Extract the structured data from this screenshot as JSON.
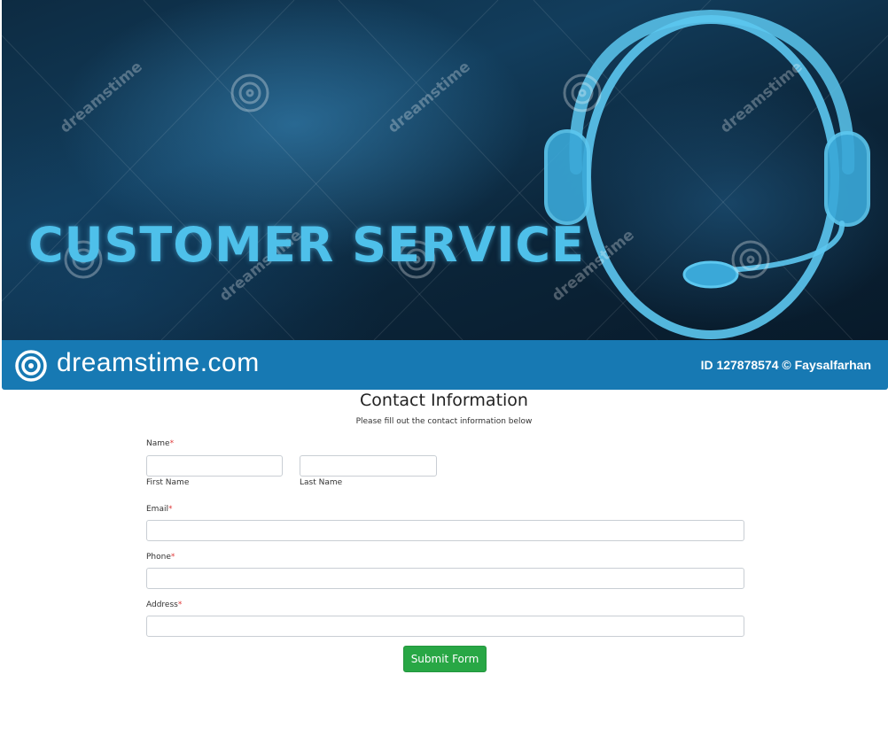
{
  "banner": {
    "headline": "CUSTOMER SERVICE",
    "watermark_text": "dreamstime",
    "brand_name": "dreamstime.com",
    "image_credit": "ID 127878574 © Faysalfarhan",
    "bar_color": "#1779b3",
    "headline_color": "#4ec0ea",
    "headset_icon": "headset-icon"
  },
  "form": {
    "title": "Contact Information",
    "subtitle": "Please fill out the contact information below",
    "name": {
      "label": "Name",
      "required_mark": "*",
      "first_name_label": "First Name",
      "first_name_value": "",
      "last_name_label": "Last Name",
      "last_name_value": ""
    },
    "email": {
      "label": "Email",
      "required_mark": "*",
      "value": ""
    },
    "phone": {
      "label": "Phone",
      "required_mark": "*",
      "value": ""
    },
    "address": {
      "label": "Address",
      "required_mark": "*",
      "value": ""
    },
    "submit_label": "Submit Form",
    "submit_color": "#28a745",
    "required_color": "#e03a3a"
  }
}
